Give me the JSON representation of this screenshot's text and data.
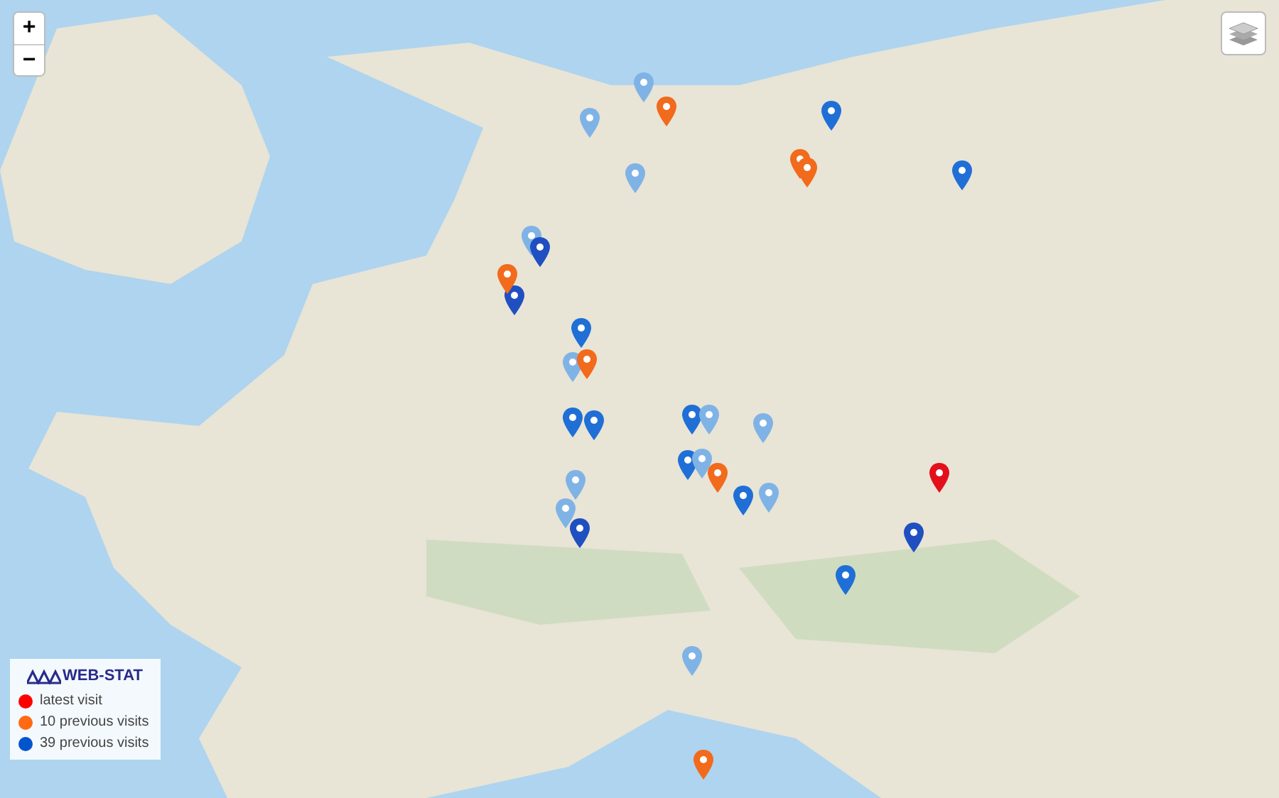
{
  "zoom_controls": {
    "zoom_in": "+",
    "zoom_out": "−"
  },
  "pins": [
    {
      "color": "#7fb3e6"
    },
    {
      "color": "#7fb3e6"
    },
    {
      "color": "#7fb3e6"
    },
    {
      "color": "#7fb3e6"
    },
    {
      "color": "#1f6fd6"
    },
    {
      "color": "#1f6fd6"
    },
    {
      "color": "#1f6fd6"
    },
    {
      "color": "#1f4fc0"
    },
    {
      "color": "#1f6fd6"
    },
    {
      "color": "#7fb3e6"
    },
    {
      "color": "#1f4fc0"
    },
    {
      "color": "#1f6fd6"
    },
    {
      "color": "#1f6fd6"
    },
    {
      "color": "#7fb3e6"
    },
    {
      "color": "#7fb3e6"
    },
    {
      "color": "#1f6fd6"
    },
    {
      "color": "#7fb3e6"
    },
    {
      "color": "#1f6fd6"
    },
    {
      "color": "#7fb3e6"
    },
    {
      "color": "#7fb3e6"
    },
    {
      "color": "#7fb3e6"
    },
    {
      "color": "#1f4fc0"
    },
    {
      "color": "#1f4fc0"
    },
    {
      "color": "#1f6fd6"
    },
    {
      "color": "#7fb3e6"
    },
    {
      "color": "#f26a1b"
    },
    {
      "color": "#f26a1b"
    },
    {
      "color": "#f26a1b"
    },
    {
      "color": "#f26a1b"
    },
    {
      "color": "#f26a1b"
    },
    {
      "color": "#f26a1b"
    },
    {
      "color": "#f26a1b"
    },
    {
      "color": "#e3101c"
    }
  ],
  "legend": {
    "logo": "WEB-STAT",
    "items": [
      {
        "label": "latest visit",
        "color": "#ff0000"
      },
      {
        "label": "10 previous visits",
        "color": "#ff6a13"
      },
      {
        "label": "39 previous visits",
        "color": "#0055cc"
      }
    ]
  }
}
